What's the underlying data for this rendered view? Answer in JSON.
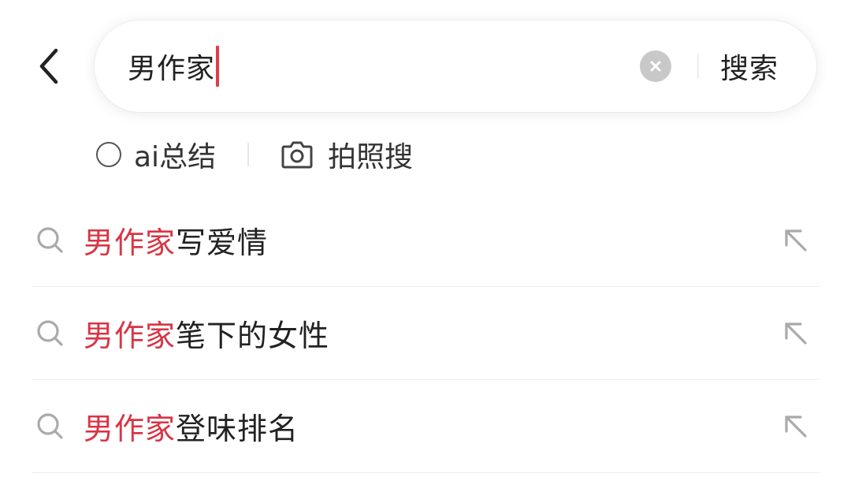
{
  "header": {
    "back_icon": "chevron-left-icon"
  },
  "search": {
    "query": "男作家",
    "clear_icon": "clear-circle-icon",
    "submit_label": "搜索"
  },
  "options": {
    "ai_summary_label": "ai总结",
    "photo_search_label": "拍照搜",
    "camera_icon": "camera-icon"
  },
  "suggestions": [
    {
      "highlight": "男作家",
      "rest": "写爱情"
    },
    {
      "highlight": "男作家",
      "rest": "笔下的女性"
    },
    {
      "highlight": "男作家",
      "rest": "登味排名"
    }
  ],
  "colors": {
    "highlight": "#d83545",
    "caret": "#e03c4a",
    "text": "#222222",
    "icon_gray": "#aaaaaa"
  }
}
